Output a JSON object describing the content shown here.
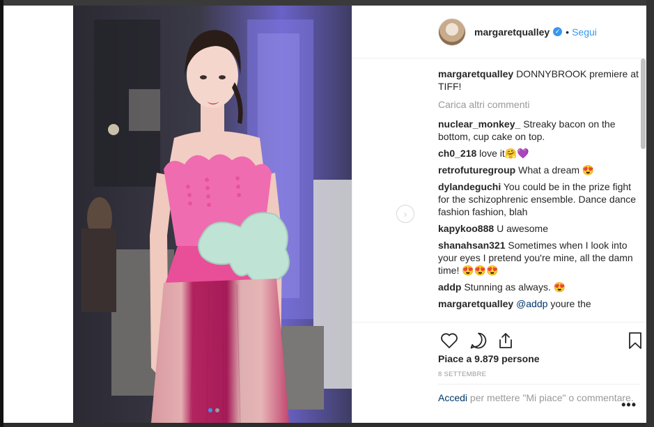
{
  "post": {
    "username": "margaretqualley",
    "follow_label": "Segui",
    "separator": "•",
    "verified_symbol": "✓",
    "caption": {
      "user": "margaretqualley",
      "text": "DONNYBROOK premiere at TIFF!"
    },
    "load_more": "Carica altri commenti",
    "comments": [
      {
        "user": "nuclear_monkey_",
        "text": "Streaky bacon on the bottom, cup cake on top."
      },
      {
        "user": "ch0_218",
        "text": "love it🤗💜"
      },
      {
        "user": "retrofuturegroup",
        "text": "What a dream 😍"
      },
      {
        "user": "dylandeguchi",
        "text": "You could be in the prize fight for the schizophrenic ensemble. Dance dance fashion fashion, blah"
      },
      {
        "user": "kapykoo888",
        "text": "U awesome"
      },
      {
        "user": "shanahsan321",
        "text": "Sometimes when I look into your eyes I pretend you're mine, all the damn time! 😍😍😍"
      },
      {
        "user": "addp",
        "text": "Stunning as always. 😍"
      },
      {
        "user": "margaretqualley",
        "mention": "@addp",
        "text": "youre the"
      }
    ],
    "likes_text": "Piace a 9.879 persone",
    "date_text": "8 SETTEMBRE",
    "login_link": "Accedi",
    "login_rest": "per mettere \"Mi piace\" o commentare.",
    "more_label": "•••",
    "next_symbol": "›",
    "carousel": {
      "count": 2,
      "active": 0
    }
  },
  "icons": {
    "like": "heart-icon",
    "comment": "comment-bubble-icon",
    "share": "share-icon",
    "save": "bookmark-icon",
    "verified": "verified-badge-icon",
    "next": "chevron-right-icon",
    "profile": "profile-switch-icon"
  },
  "colors": {
    "accent": "#3897f0",
    "text": "#262626",
    "muted": "#999999",
    "link": "#003569"
  }
}
